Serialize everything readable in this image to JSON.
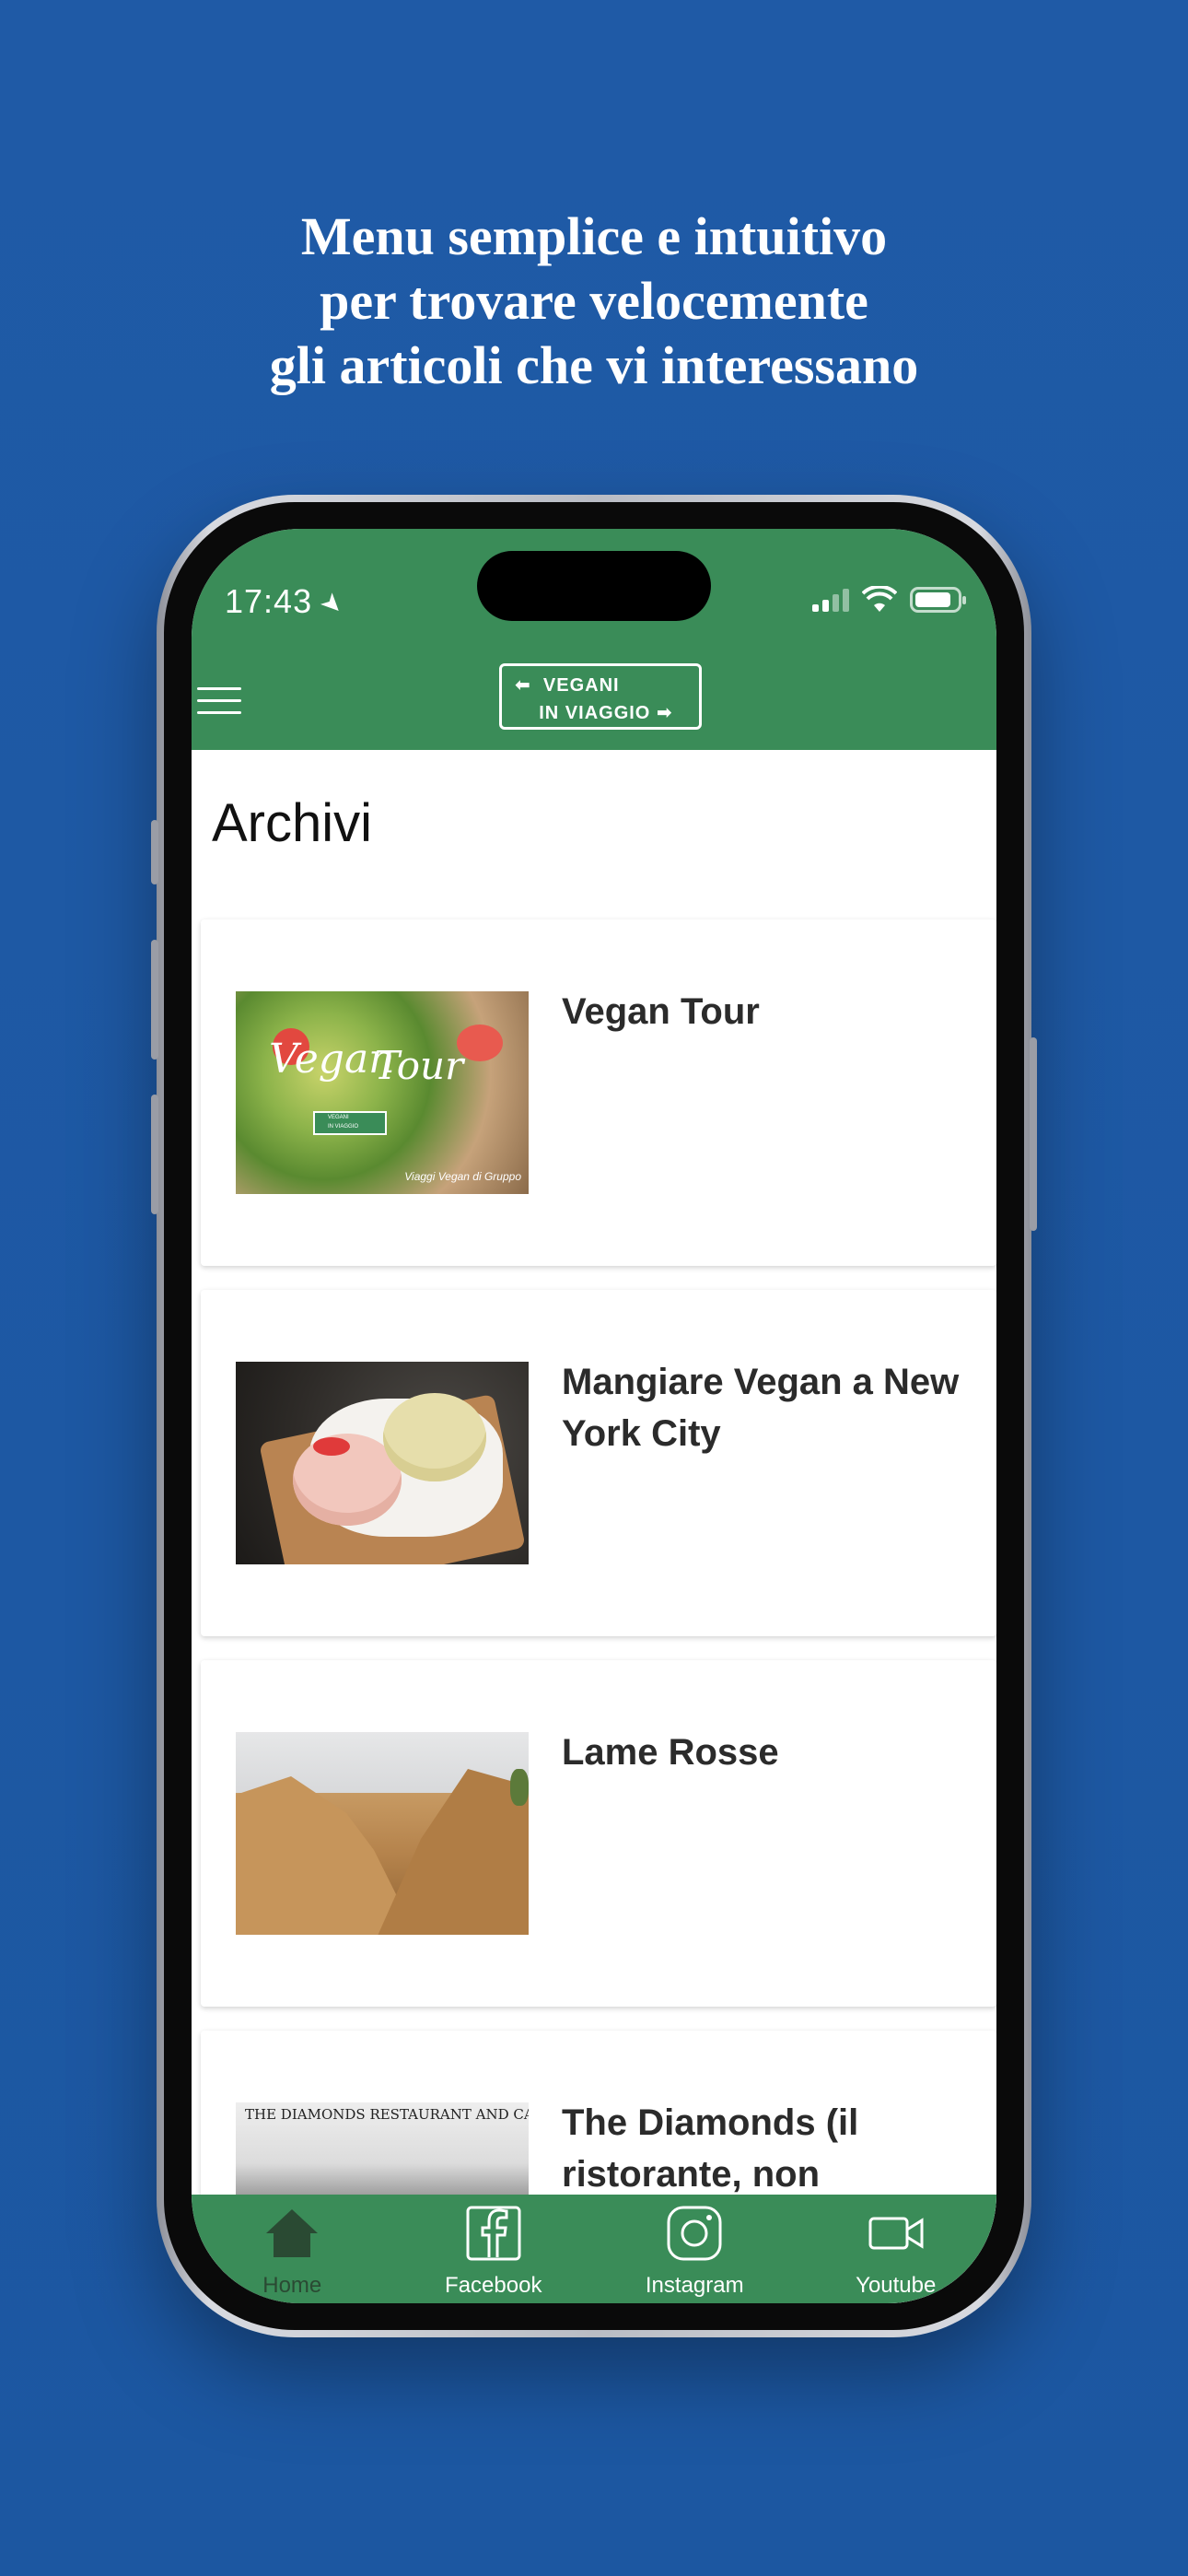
{
  "promo": {
    "line1": "Menu semplice e intuitivo",
    "line2": "per trovare velocemente",
    "line3": "gli articoli che vi interessano"
  },
  "status_bar": {
    "time": "17:43",
    "location_icon": "location-arrow-icon",
    "signal_icon": "cellular-signal-icon",
    "wifi_icon": "wifi-icon",
    "battery_icon": "battery-icon"
  },
  "header": {
    "menu_icon": "hamburger-menu-icon",
    "logo_line1": "VEGANI",
    "logo_line2": "IN VIAGGIO",
    "brand_color": "#3a8c58"
  },
  "page": {
    "title": "Archivi"
  },
  "articles": [
    {
      "title": "Vegan Tour",
      "thumb_text_1": "Vegan",
      "thumb_text_2": "Tour",
      "thumb_caption": "Viaggi Vegan di Gruppo",
      "thumb_badge_1": "VEGANI",
      "thumb_badge_2": "IN VIAGGIO"
    },
    {
      "title": "Mangiare Vegan a New York City"
    },
    {
      "title": "Lame Rosse"
    },
    {
      "title": "The Diamonds (il ristorante, non",
      "thumb_text_1": "THE DIAMONDS RESTAURANT AND CABINS"
    }
  ],
  "tabbar": {
    "items": [
      {
        "label": "Home",
        "icon": "home-icon",
        "active": true
      },
      {
        "label": "Facebook",
        "icon": "facebook-icon",
        "active": false
      },
      {
        "label": "Instagram",
        "icon": "instagram-icon",
        "active": false
      },
      {
        "label": "Youtube",
        "icon": "video-camera-icon",
        "active": false
      }
    ]
  },
  "colors": {
    "background": "#1f5aa6",
    "header_green": "#3a8c58",
    "active_tab": "#2a4a33"
  }
}
